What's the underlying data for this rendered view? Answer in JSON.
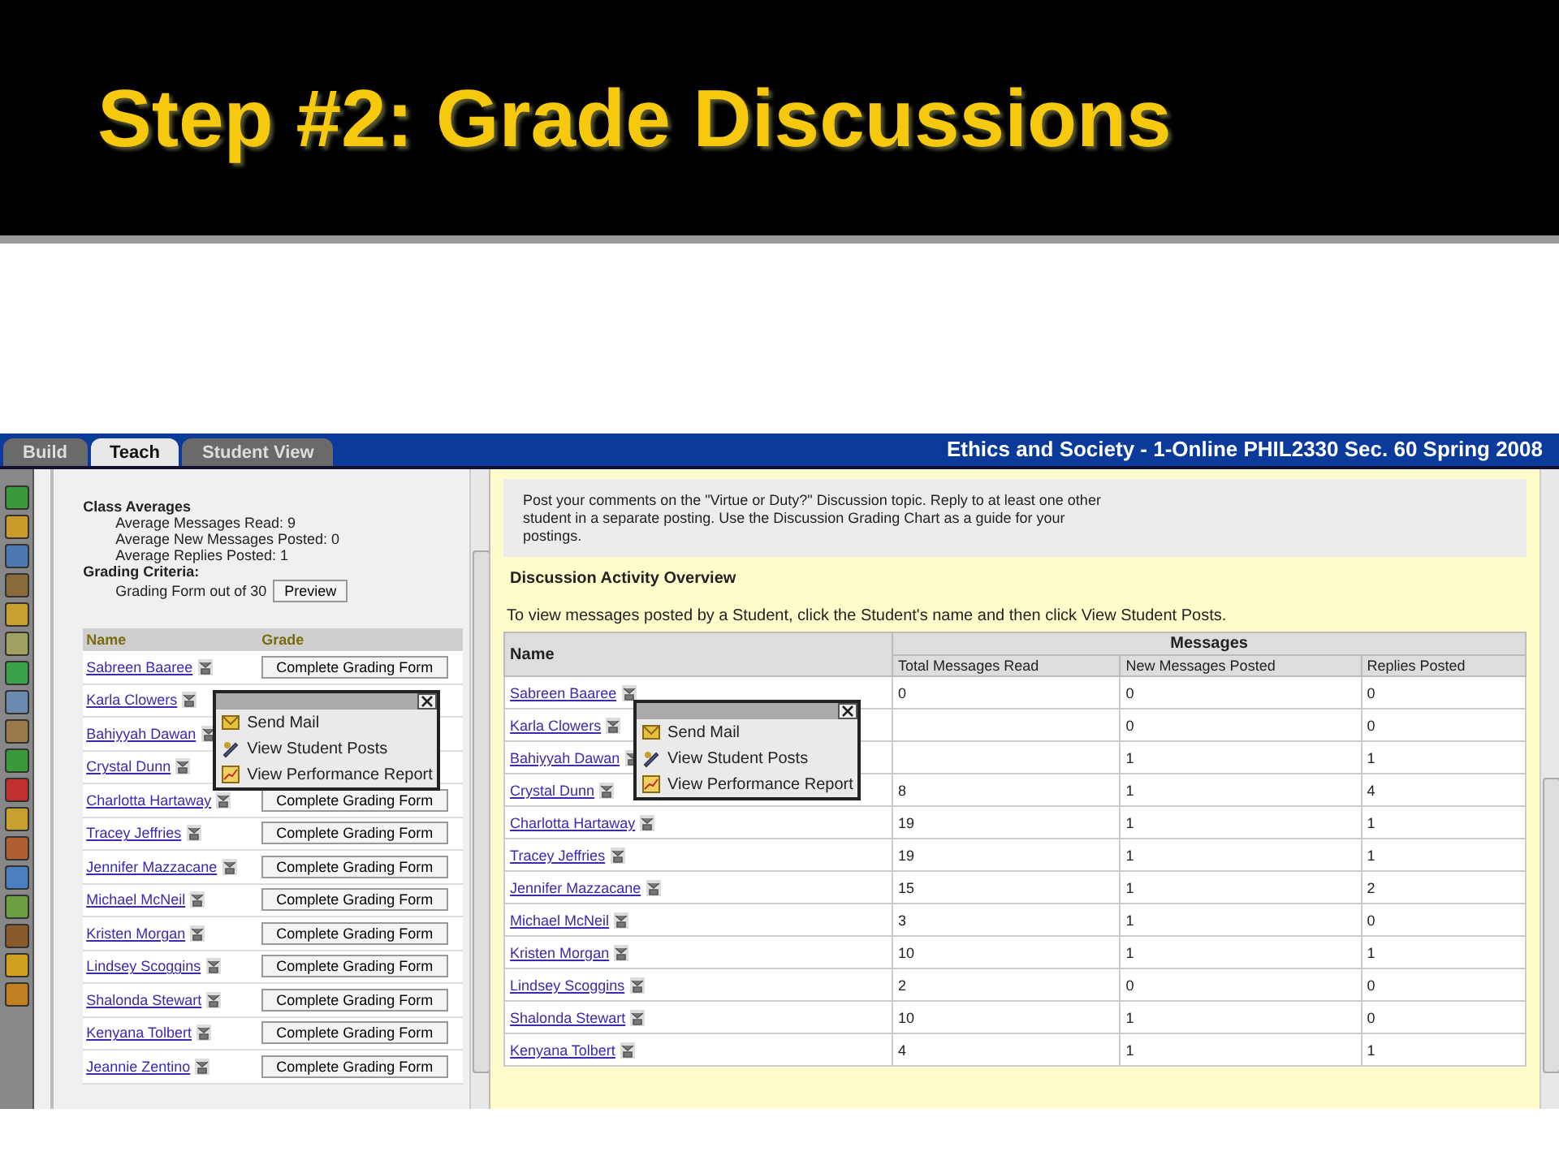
{
  "slide_title": "Step #2: Grade Discussions",
  "tabs": [
    {
      "label": "Build",
      "selected": false
    },
    {
      "label": "Teach",
      "selected": true
    },
    {
      "label": "Student View",
      "selected": false
    }
  ],
  "course_title": "Ethics and Society - 1-Online PHIL2330 Sec. 60 Spring 2008",
  "left": {
    "averages_title": "Class Averages",
    "averages": [
      "Average Messages Read: 9",
      "Average New Messages Posted: 0",
      "Average Replies Posted: 1"
    ],
    "criteria_title": "Grading Criteria:",
    "criteria_text": "Grading Form out of 30",
    "preview_button": "Preview",
    "columns": [
      "Name",
      "Grade"
    ],
    "rows": [
      {
        "name": "Sabreen Baaree",
        "grade_button": "Complete Grading Form"
      },
      {
        "name": "Karla Clowers"
      },
      {
        "name": "Bahiyyah Dawan"
      },
      {
        "name": "Crystal Dunn"
      },
      {
        "name": "Charlotta Hartaway",
        "grade_button": "Complete Grading Form"
      },
      {
        "name": "Tracey Jeffries",
        "grade_button": "Complete Grading Form"
      },
      {
        "name": "Jennifer Mazzacane",
        "grade_button": "Complete Grading Form"
      },
      {
        "name": "Michael McNeil",
        "grade_button": "Complete Grading Form"
      },
      {
        "name": "Kristen Morgan",
        "grade_button": "Complete Grading Form"
      },
      {
        "name": "Lindsey Scoggins",
        "grade_button": "Complete Grading Form"
      },
      {
        "name": "Shalonda Stewart",
        "grade_button": "Complete Grading Form"
      },
      {
        "name": "Kenyana Tolbert",
        "grade_button": "Complete Grading Form"
      },
      {
        "name": "Jeannie Zentino",
        "grade_button": "Complete Grading Form"
      }
    ],
    "popup": {
      "items": [
        "Send Mail",
        "View Student Posts",
        "View Performance Report"
      ]
    }
  },
  "right": {
    "instructions": "Post your comments on the \"Virtue or Duty?\" Discussion topic. Reply to at least one other student in a separate posting. Use the Discussion Grading Chart as a guide for your postings.",
    "section_title": "Discussion Activity Overview",
    "hint": "To view messages posted by a Student, click the Student's name and then click View Student Posts.",
    "table": {
      "name_column": "Name",
      "group_column": "Messages",
      "columns": [
        "Total Messages Read",
        "New Messages Posted",
        "Replies Posted"
      ],
      "rows": [
        {
          "name": "Sabreen Baaree",
          "total_read": "0",
          "new_posted": "0",
          "replies": "0"
        },
        {
          "name": "Karla Clowers",
          "new_posted": "0",
          "replies": "0"
        },
        {
          "name": "Bahiyyah Dawan",
          "new_posted": "1",
          "replies": "1"
        },
        {
          "name": "Crystal Dunn",
          "total_read": "8",
          "new_posted": "1",
          "replies": "4"
        },
        {
          "name": "Charlotta Hartaway",
          "total_read": "19",
          "new_posted": "1",
          "replies": "1"
        },
        {
          "name": "Tracey Jeffries",
          "total_read": "19",
          "new_posted": "1",
          "replies": "1"
        },
        {
          "name": "Jennifer Mazzacane",
          "total_read": "15",
          "new_posted": "1",
          "replies": "2"
        },
        {
          "name": "Michael McNeil",
          "total_read": "3",
          "new_posted": "1",
          "replies": "0"
        },
        {
          "name": "Kristen Morgan",
          "total_read": "10",
          "new_posted": "1",
          "replies": "1"
        },
        {
          "name": "Lindsey Scoggins",
          "total_read": "2",
          "new_posted": "0",
          "replies": "0"
        },
        {
          "name": "Shalonda Stewart",
          "total_read": "10",
          "new_posted": "1",
          "replies": "0"
        },
        {
          "name": "Kenyana Tolbert",
          "total_read": "4",
          "new_posted": "1",
          "replies": "1"
        }
      ]
    },
    "popup": {
      "items": [
        "Send Mail",
        "View Student Posts",
        "View Performance Report"
      ]
    }
  }
}
